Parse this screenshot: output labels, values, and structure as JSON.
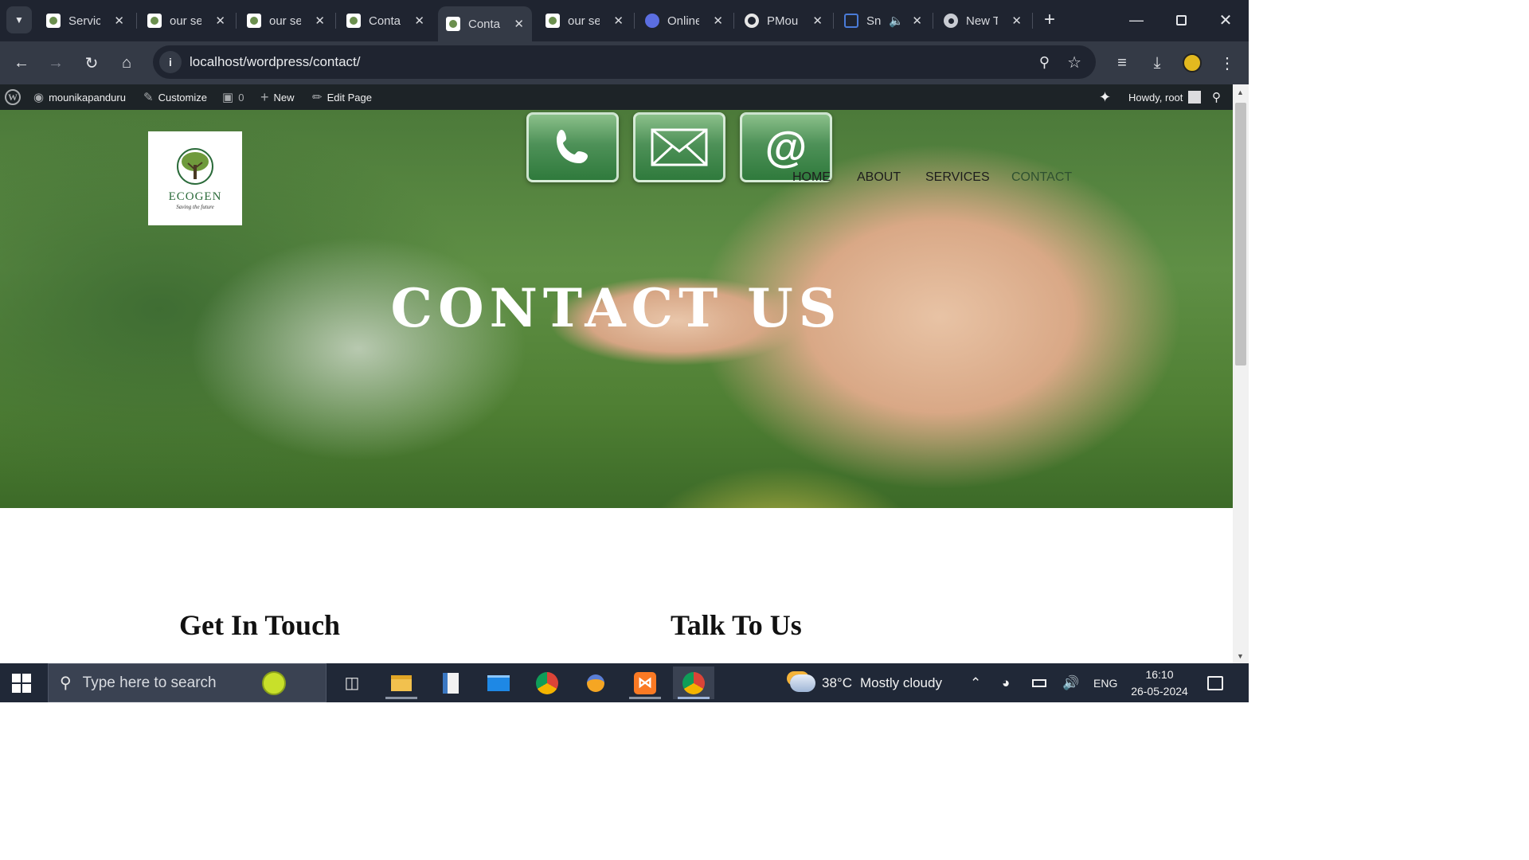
{
  "browser": {
    "tabs": [
      {
        "title": "Services",
        "icon": "site-favicon"
      },
      {
        "title": "our services",
        "icon": "site-favicon"
      },
      {
        "title": "our services",
        "icon": "site-favicon"
      },
      {
        "title": "Contact",
        "icon": "site-favicon"
      },
      {
        "title": "Contact",
        "icon": "site-favicon",
        "active": true
      },
      {
        "title": "our services",
        "icon": "site-favicon"
      },
      {
        "title": "Online",
        "icon": "online-favicon"
      },
      {
        "title": "PMou",
        "icon": "github-icon"
      },
      {
        "title": "Sn",
        "icon": "snipping-favicon"
      },
      {
        "title": "New Tab",
        "icon": "chrome-icon"
      }
    ],
    "url": "localhost/wordpress/contact/"
  },
  "admin_bar": {
    "site_name": "mounikapanduru",
    "customize": "Customize",
    "comments_count": "0",
    "new": "New",
    "edit_page": "Edit Page",
    "howdy": "Howdy, root"
  },
  "site": {
    "logo_text": "ECOGEN",
    "logo_tagline": "Saving the future",
    "nav": [
      "HOME",
      "ABOUT",
      "SERVICES",
      "CONTACT"
    ],
    "active_nav": "CONTACT",
    "hero_title": "CONTACT US",
    "section_left": "Get In Touch",
    "section_right": "Talk To Us",
    "colors": {
      "active_nav": "#2f5130",
      "text": "#111111"
    }
  },
  "taskbar": {
    "search_placeholder": "Type here to search",
    "weather_temp": "38°C",
    "weather_desc": "Mostly cloudy",
    "language": "ENG",
    "time": "16:10",
    "date": "26-05-2024"
  }
}
